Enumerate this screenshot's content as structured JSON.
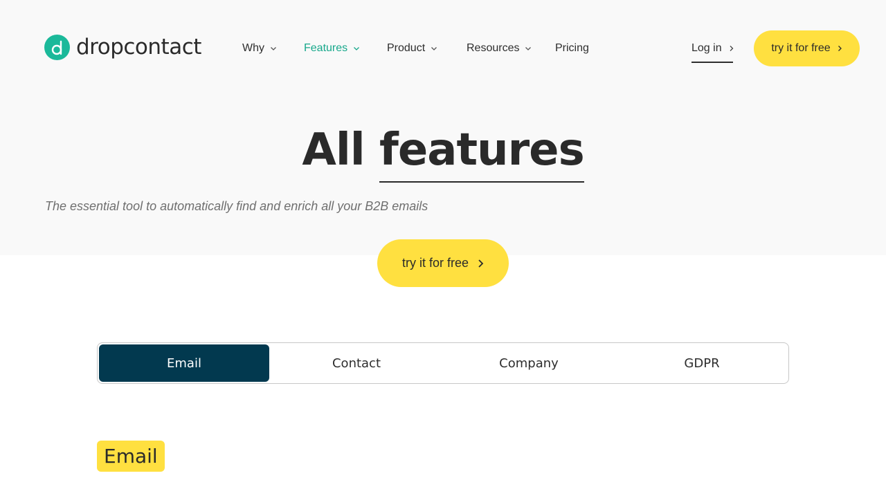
{
  "brand": {
    "name": "dropcontact",
    "accent": "#1bb99a"
  },
  "nav": {
    "items": [
      {
        "label": "Why",
        "has_dropdown": true
      },
      {
        "label": "Features",
        "has_dropdown": true,
        "active": true
      },
      {
        "label": "Product",
        "has_dropdown": true
      },
      {
        "label": "Resources",
        "has_dropdown": true
      },
      {
        "label": "Pricing",
        "has_dropdown": false
      }
    ],
    "login_label": "Log in",
    "cta_label": "try it for free"
  },
  "hero": {
    "title_plain": "All",
    "title_highlight": "features",
    "subtitle": "The essential tool to automatically find and enrich all your B2B emails",
    "cta_label": "try it for free"
  },
  "tabs": {
    "items": [
      "Email",
      "Contact",
      "Company",
      "GDPR"
    ],
    "active_index": 0
  },
  "section": {
    "title": "Email"
  },
  "colors": {
    "cta_yellow": "#ffe040",
    "tab_active_bg": "#02394f",
    "nav_active": "#17a88b"
  },
  "icons": {
    "nav_dropdown": "chevron-down-icon",
    "cta": "chevron-right-icon"
  }
}
